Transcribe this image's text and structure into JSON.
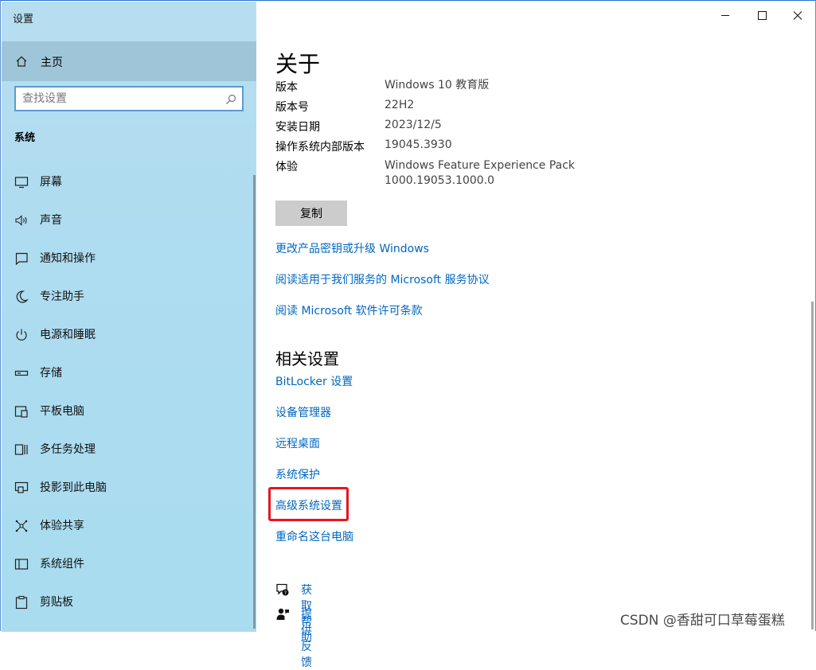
{
  "window": {
    "title": "设置"
  },
  "sidebar": {
    "home_label": "主页",
    "search_placeholder": "查找设置",
    "section_label": "系统",
    "items": [
      {
        "label": "屏幕",
        "icon": "monitor-icon"
      },
      {
        "label": "声音",
        "icon": "speaker-icon"
      },
      {
        "label": "通知和操作",
        "icon": "notification-icon"
      },
      {
        "label": "专注助手",
        "icon": "moon-icon"
      },
      {
        "label": "电源和睡眠",
        "icon": "power-icon"
      },
      {
        "label": "存储",
        "icon": "storage-icon"
      },
      {
        "label": "平板电脑",
        "icon": "tablet-icon"
      },
      {
        "label": "多任务处理",
        "icon": "multitask-icon"
      },
      {
        "label": "投影到此电脑",
        "icon": "project-icon"
      },
      {
        "label": "体验共享",
        "icon": "share-icon"
      },
      {
        "label": "系统组件",
        "icon": "components-icon"
      },
      {
        "label": "剪贴板",
        "icon": "clipboard-icon"
      }
    ]
  },
  "main": {
    "title": "关于",
    "specs": [
      {
        "label": "版本",
        "value": "Windows 10 教育版"
      },
      {
        "label": "版本号",
        "value": "22H2"
      },
      {
        "label": "安装日期",
        "value": "2023/12/5"
      },
      {
        "label": "操作系统内部版本",
        "value": "19045.3930"
      },
      {
        "label": "体验",
        "value": "Windows Feature Experience Pack",
        "value2": "1000.19053.1000.0"
      }
    ],
    "copy_label": "复制",
    "links": [
      "更改产品密钥或升级 Windows",
      "阅读适用于我们服务的 Microsoft 服务协议",
      "阅读 Microsoft 软件许可条款"
    ],
    "related_title": "相关设置",
    "related_links": [
      "BitLocker 设置",
      "设备管理器",
      "远程桌面",
      "系统保护",
      "高级系统设置",
      "重命名这台电脑"
    ],
    "help": [
      {
        "label": "获取帮助",
        "icon": "help-chat-icon"
      },
      {
        "label": "提供反馈",
        "icon": "feedback-icon"
      }
    ]
  },
  "watermark": "CSDN @香甜可口草莓蛋糕",
  "colors": {
    "accent": "#0067c0",
    "highlight": "#e8141e",
    "sidebar": "#aedcf0"
  }
}
